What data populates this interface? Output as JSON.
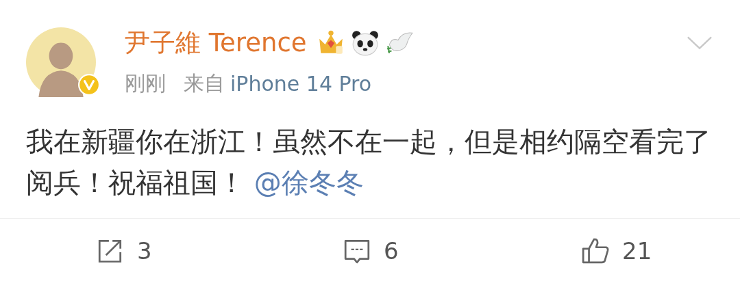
{
  "author": {
    "name": "尹子維 Terence",
    "verified": true
  },
  "meta": {
    "time": "刚刚",
    "source_prefix": "来自",
    "source": "iPhone 14 Pro"
  },
  "post": {
    "text": "我在新疆你在浙江！虽然不在一起，但是相约隔空看完了阅兵！祝福祖国！",
    "mention": "@徐冬冬"
  },
  "actions": [
    {
      "kind": "repost",
      "count": "3"
    },
    {
      "kind": "comment",
      "count": "6"
    },
    {
      "kind": "like",
      "count": "21"
    }
  ]
}
